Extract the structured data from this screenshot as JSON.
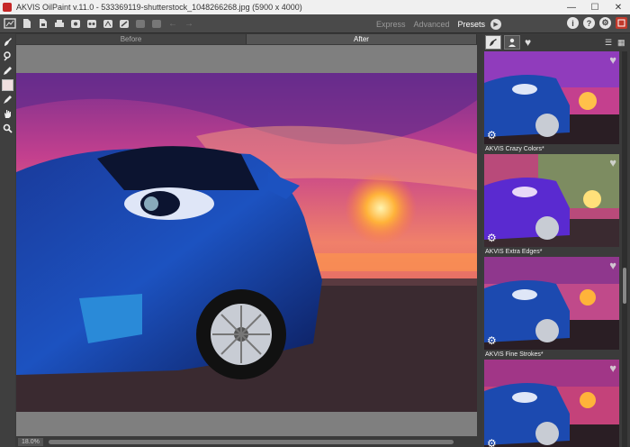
{
  "window": {
    "title": "AKVIS OilPaint v.11.0 - 533369119-shutterstock_1048266268.jpg (5900 x 4000)",
    "minimize": "—",
    "maximize": "☐",
    "close": "✕"
  },
  "toolbar": {
    "modes": [
      "Express",
      "Advanced",
      "Presets"
    ],
    "active_mode": "Presets",
    "help_symbols": {
      "info": "i",
      "help": "?",
      "settings": "⚙"
    }
  },
  "canvas": {
    "tab_before": "Before",
    "tab_after": "After",
    "zoom": "18.0%"
  },
  "presets": [
    {
      "label": "AKVIS Crazy Colors*",
      "tint": "#7a3ad0"
    },
    {
      "label": "AKVIS Extra Edges*",
      "tint": "#6aa35a"
    },
    {
      "label": "AKVIS Fine Strokes*",
      "tint": "#c04a8a"
    },
    {
      "label": "",
      "tint": "#c4427a"
    }
  ],
  "colors": {
    "accent": "#c62828",
    "panel": "#3b3b3b",
    "canvas_bg": "#7f7f7f"
  }
}
